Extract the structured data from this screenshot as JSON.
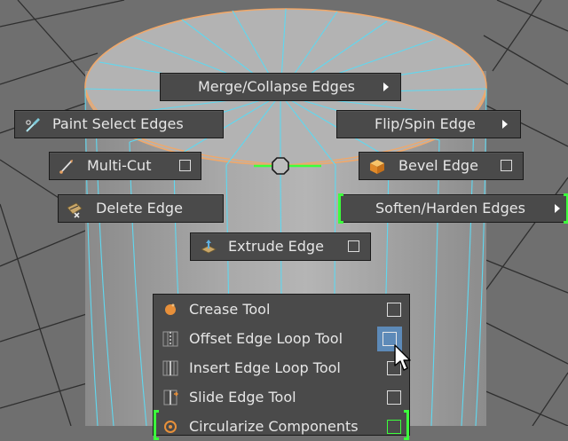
{
  "colors": {
    "background": "#6f6f6f",
    "menu_bg": "#4a4a4a",
    "wire": "#5fd8f0",
    "selected_edge": "#3cff3c",
    "top_outline": "#f0a86a",
    "highlight": "#5d8ab8"
  },
  "marking_menu": {
    "north": {
      "label": "Merge/Collapse Edges",
      "has_submenu": true
    },
    "north_west": {
      "label": "Paint Select Edges",
      "icon": "paint-select-icon"
    },
    "north_east": {
      "label": "Flip/Spin Edge",
      "has_submenu": true
    },
    "west": {
      "label": "Multi-Cut",
      "icon": "multi-cut-knife-icon",
      "has_options": true
    },
    "east": {
      "label": "Bevel Edge",
      "icon": "bevel-cube-icon",
      "has_options": true
    },
    "south_west": {
      "label": "Delete Edge",
      "icon": "delete-edge-icon"
    },
    "south_east": {
      "label": "Soften/Harden Edges",
      "has_submenu": true,
      "selected": true
    },
    "south": {
      "label": "Extrude Edge",
      "icon": "extrude-edge-icon",
      "has_options": true
    }
  },
  "list_menu": {
    "items": [
      {
        "label": "Crease Tool",
        "icon": "crease-dot-icon"
      },
      {
        "label": "Offset Edge Loop Tool",
        "icon": "offset-loop-icon",
        "hover": true
      },
      {
        "label": "Insert Edge Loop Tool",
        "icon": "insert-loop-icon"
      },
      {
        "label": "Slide Edge Tool",
        "icon": "slide-edge-icon"
      },
      {
        "label": "Circularize Components",
        "icon": "circularize-icon",
        "selected": true
      }
    ]
  }
}
